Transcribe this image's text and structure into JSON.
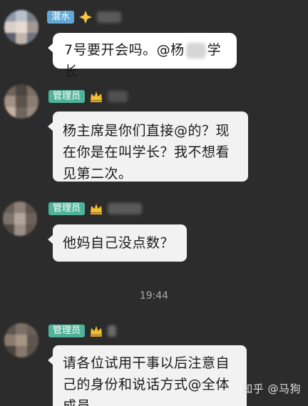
{
  "messages": [
    {
      "role_tag": "潜水",
      "text_before": "7号要开会吗。@杨",
      "text_after": "学长"
    },
    {
      "role_tag": "管理员",
      "text": "杨主席是你们直接@的？现在你是在叫学长？我不想看见第二次。"
    },
    {
      "role_tag": "管理员",
      "text": "他妈自己没点数？"
    },
    {
      "role_tag": "管理员",
      "text": "请各位试用干事以后注意自己的身份和说话方式@全体成员"
    }
  ],
  "timestamp": "19:44",
  "watermark": "知乎 @马狗",
  "colors": {
    "background": "#2c2c2c",
    "member_tag": "#62a8d6",
    "admin_tag": "#4fb39a",
    "bubble": "#f2f2f2"
  },
  "icons": {
    "member_badge": "diamond-sparkle-icon",
    "admin_badge": "crown-icon"
  }
}
